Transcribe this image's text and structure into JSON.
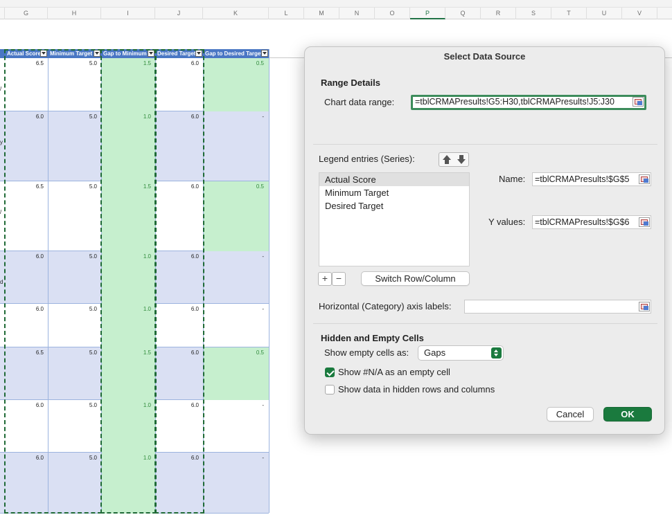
{
  "sheet": {
    "columns": [
      "G",
      "H",
      "I",
      "J",
      "K",
      "L",
      "M",
      "N",
      "O",
      "P",
      "Q",
      "R",
      "S",
      "T",
      "U",
      "V"
    ],
    "selected_column": "P",
    "table_headers": [
      "Actual Score",
      "Minimum Target",
      "Gap to Minimum",
      "Desired Target",
      "Gap to Desired Target"
    ],
    "rows": [
      {
        "actual": "6.5",
        "min": "5.0",
        "gap_min": "1.5",
        "desired": "6.0",
        "gap_desired": "0.5",
        "left": "/"
      },
      {
        "actual": "6.0",
        "min": "5.0",
        "gap_min": "1.0",
        "desired": "6.0",
        "gap_desired": "-",
        "left": "y"
      },
      {
        "actual": "6.5",
        "min": "5.0",
        "gap_min": "1.5",
        "desired": "6.0",
        "gap_desired": "0.5",
        "left": "/"
      },
      {
        "actual": "6.0",
        "min": "5.0",
        "gap_min": "1.0",
        "desired": "6.0",
        "gap_desired": "-",
        "left": "d"
      },
      {
        "actual": "6.0",
        "min": "5.0",
        "gap_min": "1.0",
        "desired": "6.0",
        "gap_desired": "-",
        "left": ""
      },
      {
        "actual": "6.5",
        "min": "5.0",
        "gap_min": "1.5",
        "desired": "6.0",
        "gap_desired": "0.5",
        "left": ""
      },
      {
        "actual": "6.0",
        "min": "5.0",
        "gap_min": "1.0",
        "desired": "6.0",
        "gap_desired": "-",
        "left": ""
      },
      {
        "actual": "6.0",
        "min": "5.0",
        "gap_min": "1.0",
        "desired": "6.0",
        "gap_desired": "-",
        "left": ""
      }
    ]
  },
  "dialog": {
    "title": "Select Data Source",
    "range_details_title": "Range Details",
    "chart_range_label": "Chart data range:",
    "chart_range_value": "=tblCRMAPresults!G5:H30,tblCRMAPresults!J5:J30",
    "legend_label": "Legend entries (Series):",
    "series": [
      "Actual Score",
      "Minimum Target",
      "Desired Target"
    ],
    "selected_series": "Actual Score",
    "name_label": "Name:",
    "name_value": "=tblCRMAPresults!$G$5",
    "yvalues_label": "Y values:",
    "yvalues_value": "=tblCRMAPresults!$G$6",
    "add_symbol": "+",
    "remove_symbol": "−",
    "switch_label": "Switch Row/Column",
    "axis_labels_label": "Horizontal (Category) axis labels:",
    "axis_labels_value": "",
    "hidden_title": "Hidden and Empty Cells",
    "show_empty_label": "Show empty cells as:",
    "show_empty_value": "Gaps",
    "show_na_label": "Show #N/A as an empty cell",
    "show_na_checked": true,
    "show_hidden_label": "Show data in hidden rows and columns",
    "show_hidden_checked": false,
    "cancel_label": "Cancel",
    "ok_label": "OK"
  },
  "colors": {
    "accent": "#1a7a3e",
    "table_header": "#4a77c4",
    "band_blue": "#dae0f3",
    "gap_fill": "#c6efce"
  }
}
